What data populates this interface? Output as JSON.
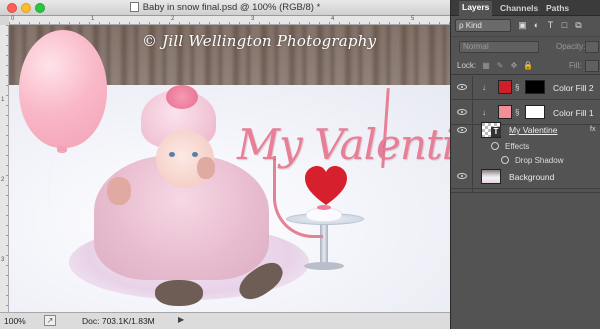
{
  "window": {
    "title": "Baby in snow final.psd @ 100% (RGB/8) *"
  },
  "rulers": {
    "top_labels": [
      "0",
      "1",
      "2",
      "3",
      "4",
      "5"
    ],
    "left_labels": [
      "1",
      "2",
      "3"
    ]
  },
  "canvas": {
    "watermark": "© Jill Wellington Photography",
    "headline": "My Valentine"
  },
  "status": {
    "zoom": "100%",
    "doc_info": "Doc: 703.1K/1.83M",
    "arrow": "▶"
  },
  "panel": {
    "tabs": [
      {
        "label": "Layers",
        "active": true
      },
      {
        "label": "Channels",
        "active": false
      },
      {
        "label": "Paths",
        "active": false
      }
    ],
    "filter": {
      "kind_label": "ρ Kind",
      "icons": [
        "image-filter-icon",
        "adjustment-filter-icon",
        "type-filter-icon",
        "shape-filter-icon",
        "smart-object-filter-icon"
      ],
      "icon_glyphs": [
        "▣",
        "◐",
        "T",
        "□",
        "⧉"
      ]
    },
    "blend_mode": "Normal",
    "opacity_label": "Opacity:",
    "lock_label": "Lock:",
    "lock_glyphs": [
      "▦",
      "✎",
      "✥",
      "🔒"
    ],
    "fill_label": "Fill:",
    "layers": [
      {
        "name": "Color Fill 2",
        "swatch": "#d01f2a",
        "mask": "black",
        "visible": true
      },
      {
        "name": "Color Fill 1",
        "swatch": "#ef8f9a",
        "mask": "white",
        "visible": true
      },
      {
        "name": "My Valentine",
        "type": "text",
        "visible": true,
        "fx": "fx"
      },
      {
        "name": "Effects",
        "type": "effects-header"
      },
      {
        "name": "Drop Shadow",
        "type": "effect"
      },
      {
        "name": "Background",
        "type": "image",
        "visible": true
      }
    ]
  },
  "colors": {
    "panel_bg": "#535353",
    "accent_pink": "#e77f96",
    "heart_red": "#d6202e"
  }
}
